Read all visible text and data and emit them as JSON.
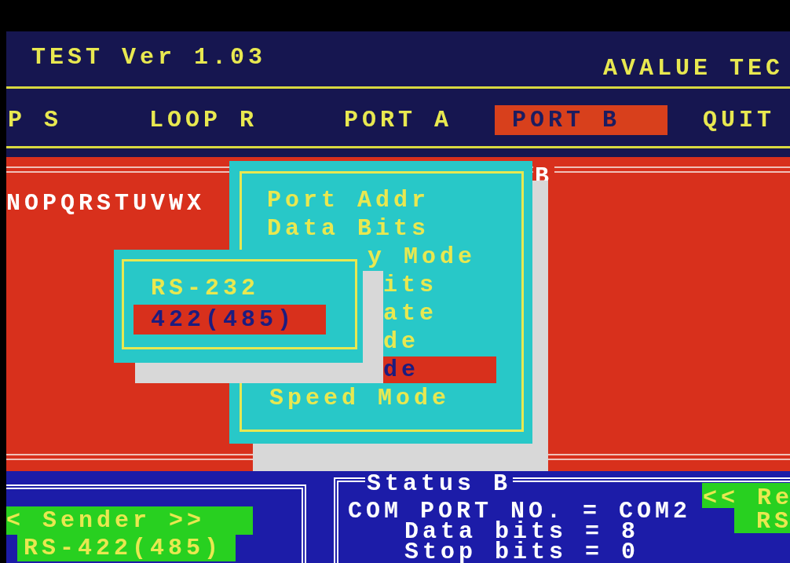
{
  "header": {
    "title": "TEST Ver 1.03",
    "company": "AVALUE TEC"
  },
  "menu": [
    {
      "label": "P S",
      "selected": false
    },
    {
      "label": "LOOP R",
      "selected": false
    },
    {
      "label": "PORT A",
      "selected": false
    },
    {
      "label": "PORT B",
      "selected": true
    },
    {
      "label": "QUIT",
      "selected": false
    }
  ],
  "sender_panel": {
    "text": "NOPQRSTUVWX",
    "corner_label": "B"
  },
  "port_menu": [
    {
      "label": "Port Addr",
      "selected": false
    },
    {
      "label": "Data Bits",
      "selected": false
    },
    {
      "label": "y Mode",
      "selected": false
    },
    {
      "label": "its",
      "selected": false
    },
    {
      "label": "ate",
      "selected": false
    },
    {
      "label": "de",
      "selected": false
    },
    {
      "label": "de",
      "selected": true
    },
    {
      "label": "Speed Mode",
      "selected": false
    }
  ],
  "mode_menu": [
    {
      "label": "RS-232",
      "selected": false
    },
    {
      "label": "422(485)",
      "selected": true
    }
  ],
  "sender": {
    "title": "< Sender >>",
    "mode": "RS-422(485)"
  },
  "status": {
    "title": "Status B",
    "lines": [
      "COM PORT NO. = COM2",
      "Data bits = 8",
      "Stop bits = 0"
    ]
  },
  "receiver": {
    "title": "<< Re",
    "mode": "RS"
  }
}
